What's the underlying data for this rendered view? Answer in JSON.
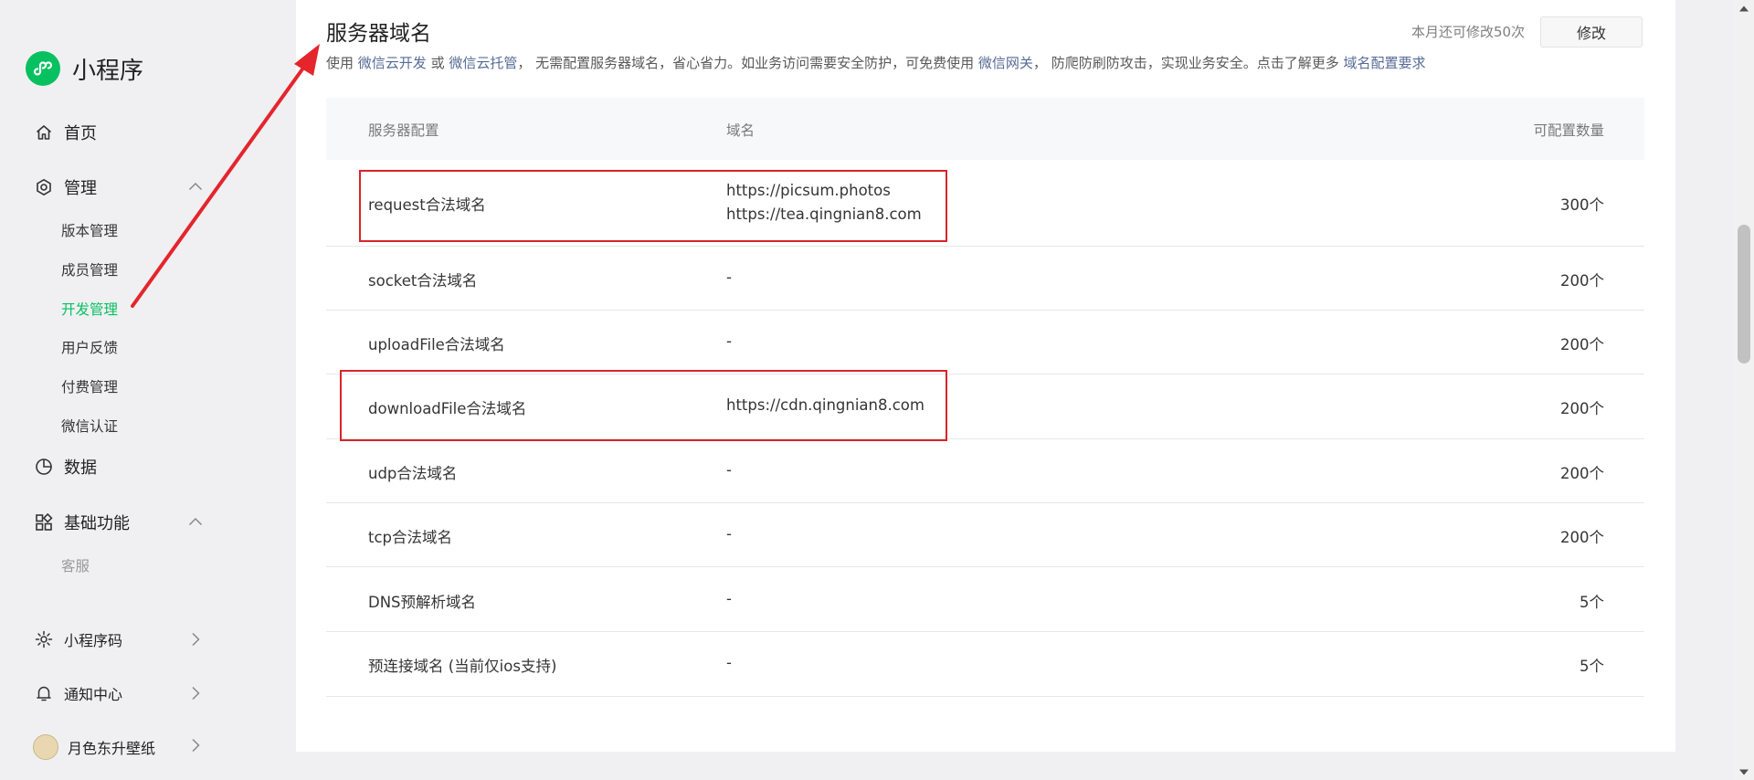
{
  "app": {
    "name": "小程序"
  },
  "sidebar": {
    "home": "首页",
    "manage": {
      "label": "管理",
      "items": [
        "版本管理",
        "成员管理",
        "开发管理",
        "用户反馈",
        "付费管理",
        "微信认证"
      ],
      "active": "开发管理"
    },
    "data": "数据",
    "basic": {
      "label": "基础功能",
      "items": [
        "客服"
      ]
    },
    "bottom": {
      "qrcode": "小程序码",
      "notify": "通知中心",
      "account": "月色东升壁纸"
    }
  },
  "section": {
    "title": "服务器域名",
    "description": {
      "p1": "使用 ",
      "link1": "微信云开发",
      "p2": " 或 ",
      "link2": "微信云托管",
      "p3": "， 无需配置服务器域名，省心省力。如业务访问需要安全防护，可免费使用 ",
      "link3": "微信网关",
      "p4": "， 防爬防刷防攻击，实现业务安全。点击了解更多 ",
      "link4": "域名配置要求"
    },
    "quota_text": "本月还可修改50次",
    "modify_button": "修改"
  },
  "table": {
    "headers": {
      "config": "服务器配置",
      "domain": "域名",
      "count": "可配置数量"
    },
    "rows": [
      {
        "name": "request合法域名",
        "domains": [
          "https://picsum.photos",
          "https://tea.qingnian8.com"
        ],
        "count": "300个",
        "highlighted": true
      },
      {
        "name": "socket合法域名",
        "domains": [
          "-"
        ],
        "count": "200个",
        "highlighted": false
      },
      {
        "name": "uploadFile合法域名",
        "domains": [
          "-"
        ],
        "count": "200个",
        "highlighted": false
      },
      {
        "name": "downloadFile合法域名",
        "domains": [
          "https://cdn.qingnian8.com"
        ],
        "count": "200个",
        "highlighted": true
      },
      {
        "name": "udp合法域名",
        "domains": [
          "-"
        ],
        "count": "200个",
        "highlighted": false
      },
      {
        "name": "tcp合法域名",
        "domains": [
          "-"
        ],
        "count": "200个",
        "highlighted": false
      },
      {
        "name": "DNS预解析域名",
        "domains": [
          "-"
        ],
        "count": "5个",
        "highlighted": false
      },
      {
        "name": "预连接域名 (当前仅ios支持)",
        "domains": [
          "-"
        ],
        "count": "5个",
        "highlighted": false
      }
    ]
  },
  "colors": {
    "brand": "#07c160",
    "link": "#576b95",
    "annotation": "#d9232a"
  },
  "icons": [
    "logo-icon",
    "home-icon",
    "manage-icon",
    "chevron-up-icon",
    "data-icon",
    "basic-icon",
    "qrcode-icon",
    "bell-icon",
    "chevron-right-icon",
    "annotation-arrow"
  ]
}
